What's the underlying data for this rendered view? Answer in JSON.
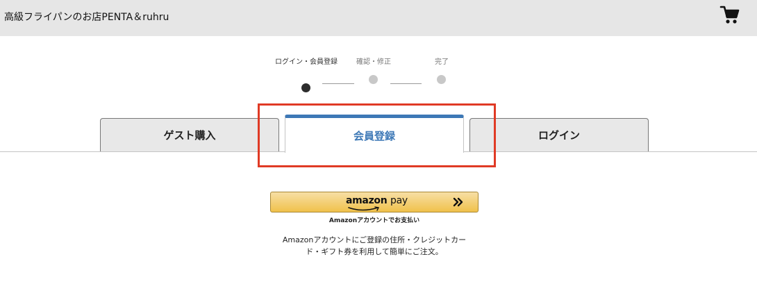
{
  "header": {
    "shop_title": "高級フライパンのお店PENTA＆ruhru",
    "cart_icon": "cart-icon"
  },
  "steps": {
    "items": [
      {
        "label": "ログイン・会員登録",
        "state": "current"
      },
      {
        "label": "確認・修正",
        "state": "upcoming"
      },
      {
        "label": "完了",
        "state": "upcoming"
      }
    ]
  },
  "tabs": {
    "items": [
      {
        "label": "ゲスト購入",
        "active": false
      },
      {
        "label": "会員登録",
        "active": true
      },
      {
        "label": "ログイン",
        "active": false
      }
    ]
  },
  "amazon_pay": {
    "logo_amazon": "amazon",
    "logo_pay": "pay",
    "caption": "Amazonアカウントでお支払い",
    "description_line1": "Amazonアカウントにご登録の住所・クレジットカー",
    "description_line2": "ド・ギフト券を利用して簡単にご注文。"
  },
  "colors": {
    "header_bg": "#e6e6e6",
    "active_tab": "#3d78b6",
    "highlight": "#e03a25",
    "amazon_button": "#f0c14b"
  }
}
